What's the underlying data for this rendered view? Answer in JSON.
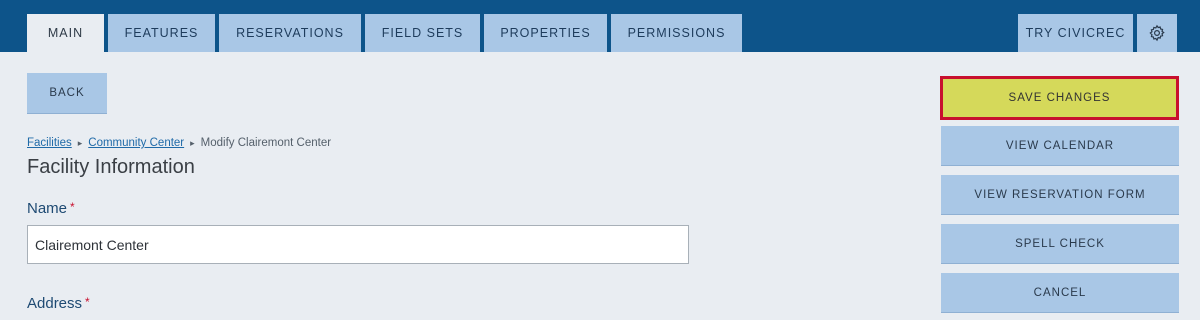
{
  "tabs": {
    "main": "Main",
    "features": "Features",
    "reservations": "Reservations",
    "field_sets": "Field Sets",
    "properties": "Properties",
    "permissions": "Permissions",
    "try_civicrec": "Try CivicRec",
    "settings_icon": "gear-icon"
  },
  "actions": {
    "back": "Back",
    "save_changes": "Save Changes",
    "view_calendar": "View Calendar",
    "view_reservation_form": "View Reservation Form",
    "spell_check": "Spell Check",
    "cancel": "Cancel"
  },
  "breadcrumb": {
    "items": [
      "Facilities",
      "Community Center"
    ],
    "current": "Modify Clairemont Center",
    "separator": "▸"
  },
  "page": {
    "title": "Facility Information"
  },
  "form": {
    "name_label": "Name",
    "name_value": "Clairemont Center",
    "address_label": "Address",
    "required_marker": "*"
  },
  "colors": {
    "topbar": "#0d548a",
    "tab": "#a9c7e6",
    "active_tab": "#e9edf2",
    "save_button": "#d5d95a",
    "save_border": "#c8102e",
    "page_bg": "#e9edf2"
  }
}
